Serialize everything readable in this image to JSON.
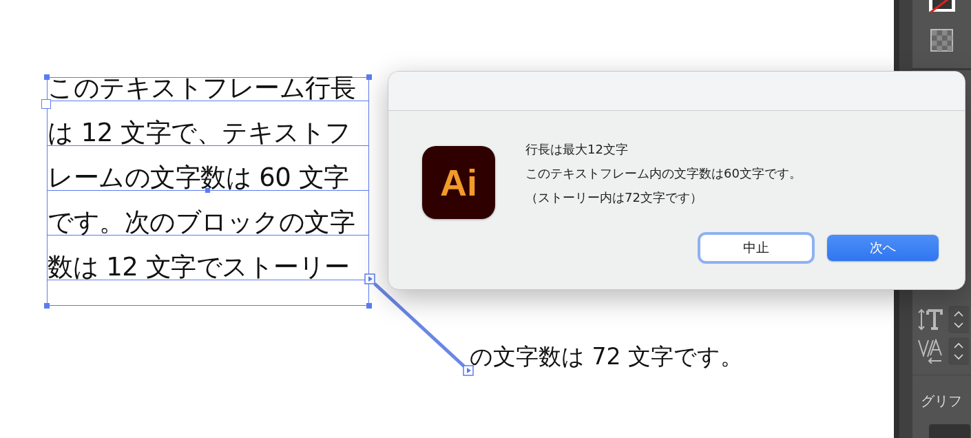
{
  "canvas": {
    "text_frame": {
      "lines": [
        "このテキストフレーム行長",
        "は 12 文字で、テキストフ",
        "レームの文字数は 60 文字",
        "です。次のブロックの文字",
        "数は 12 文字でストーリー"
      ]
    },
    "linked_frame": {
      "lines": [
        "の文字数は 72 文字です。"
      ]
    }
  },
  "dialog": {
    "app_icon": "Ai",
    "messages": [
      "行長は最大12文字",
      "このテキストフレーム内の文字数は60文字です。",
      "（ストーリー内は72文字です）"
    ],
    "buttons": [
      {
        "label": "中止",
        "kind": "secondary",
        "focused": true
      },
      {
        "label": "次へ",
        "kind": "default",
        "focused": false
      }
    ]
  },
  "panel": {
    "section_label": "グリフ"
  }
}
